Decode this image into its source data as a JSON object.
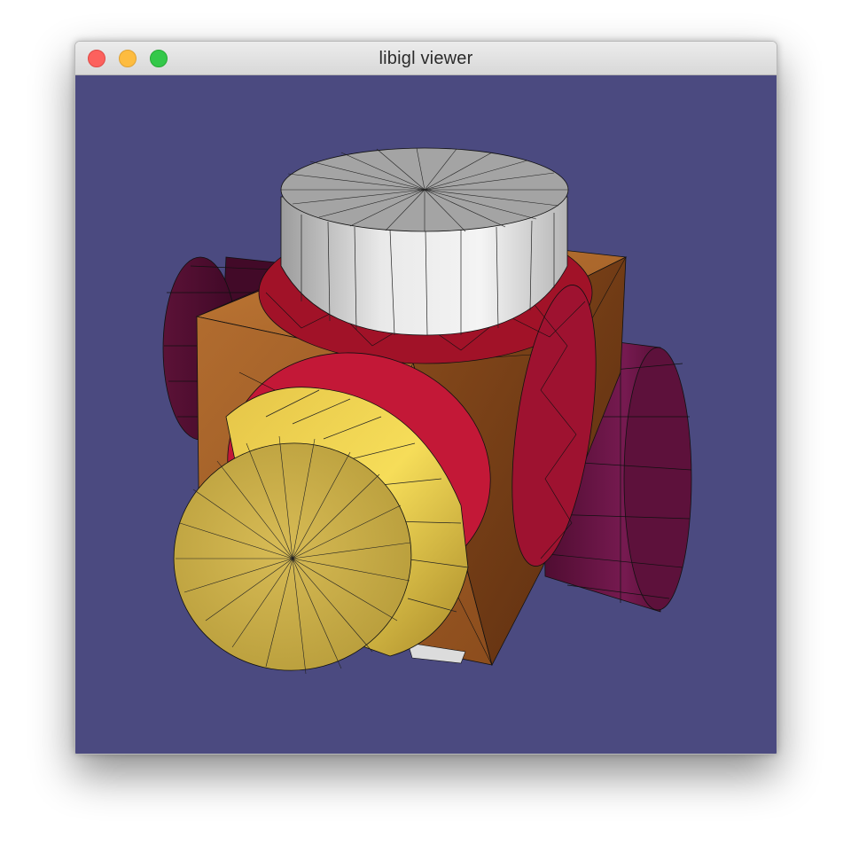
{
  "window": {
    "title": "libigl viewer",
    "buttons": [
      {
        "name": "close",
        "color": "#fc615d"
      },
      {
        "name": "minimize",
        "color": "#fdbc40"
      },
      {
        "name": "maximize",
        "color": "#34c84a"
      }
    ]
  },
  "viewport": {
    "background": "#4b4a80",
    "mesh_colors": {
      "cube": "#a4652c",
      "rings": "#c41837",
      "top_cylinder": "#d8d8d8",
      "front_cylinder": "#e2c44d",
      "side_cylinders": "#6b1448"
    }
  }
}
